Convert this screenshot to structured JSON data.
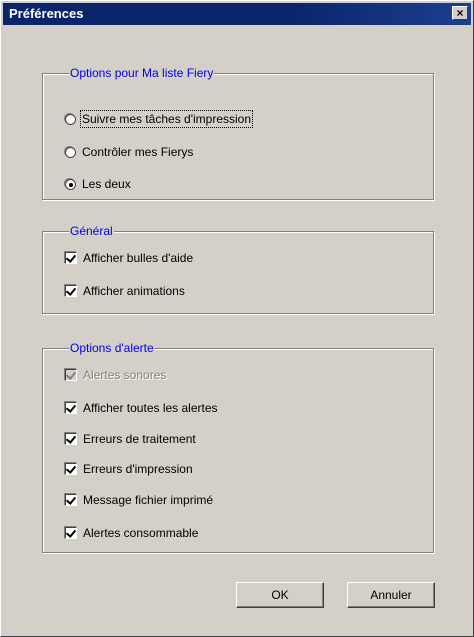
{
  "window": {
    "title": "Préférences",
    "close_label": "×"
  },
  "fiery_options": {
    "legend": "Options pour Ma liste Fiery",
    "items": [
      {
        "label": "Suivre mes tâches d'impression",
        "selected": false
      },
      {
        "label": "Contrôler mes Fierys",
        "selected": false
      },
      {
        "label": "Les deux",
        "selected": true
      }
    ]
  },
  "general": {
    "legend": "Général",
    "items": [
      {
        "label": "Afficher bulles d'aide",
        "checked": true
      },
      {
        "label": "Afficher animations",
        "checked": true
      }
    ]
  },
  "alerts": {
    "legend": "Options d'alerte",
    "items": [
      {
        "label": "Alertes sonores",
        "checked": true,
        "disabled": true
      },
      {
        "label": "Afficher toutes les alertes",
        "checked": true
      },
      {
        "label": "Erreurs de traitement",
        "checked": true
      },
      {
        "label": "Erreurs d'impression",
        "checked": true
      },
      {
        "label": "Message fichier imprimé",
        "checked": true
      },
      {
        "label": "Alertes consommable",
        "checked": true
      }
    ]
  },
  "buttons": {
    "ok": "OK",
    "cancel": "Annuler"
  }
}
